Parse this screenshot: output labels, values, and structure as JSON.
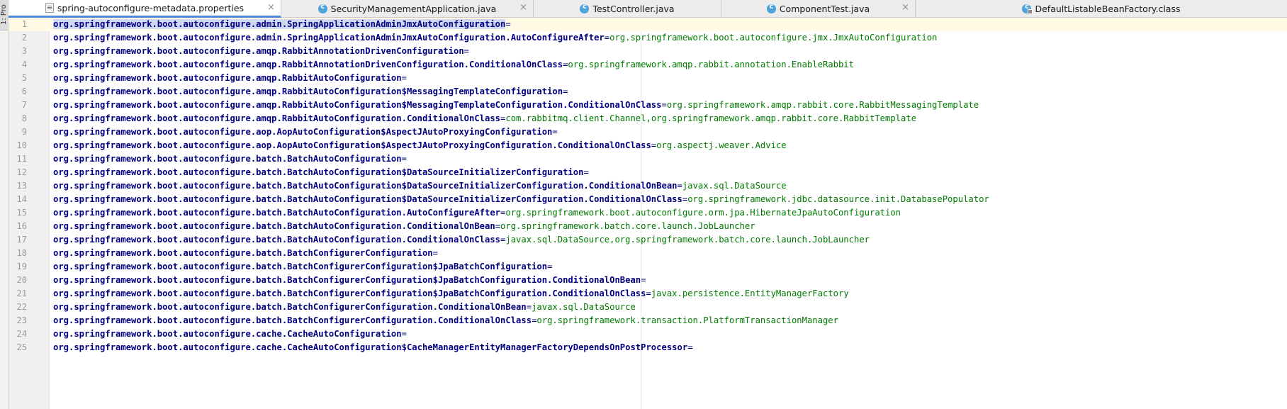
{
  "side_panel": {
    "label": "1: Pro"
  },
  "tabs": [
    {
      "label": "spring-autoconfigure-metadata.properties",
      "icon": "properties-file-icon",
      "active": true,
      "closable": true
    },
    {
      "label": "SecurityManagementApplication.java",
      "icon": "java-class-icon",
      "active": false,
      "closable": true
    },
    {
      "label": "TestController.java",
      "icon": "java-class-icon",
      "active": false,
      "closable": true
    },
    {
      "label": "ComponentTest.java",
      "icon": "java-class-icon",
      "active": false,
      "closable": true
    },
    {
      "label": "DefaultListableBeanFactory.class",
      "icon": "compiled-class-icon",
      "active": false,
      "closable": false
    }
  ],
  "close_glyph": "×",
  "editor": {
    "current_line": 1,
    "lines": [
      {
        "n": "1",
        "key": "org.springframework.boot.autoconfigure.admin.SpringApplicationAdminJmxAutoConfiguration",
        "eq": "=",
        "value": ""
      },
      {
        "n": "2",
        "key": "org.springframework.boot.autoconfigure.admin.SpringApplicationAdminJmxAutoConfiguration.AutoConfigureAfter",
        "eq": "=",
        "value": "org.springframework.boot.autoconfigure.jmx.JmxAutoConfiguration"
      },
      {
        "n": "3",
        "key": "org.springframework.boot.autoconfigure.amqp.RabbitAnnotationDrivenConfiguration",
        "eq": "=",
        "value": ""
      },
      {
        "n": "4",
        "key": "org.springframework.boot.autoconfigure.amqp.RabbitAnnotationDrivenConfiguration.ConditionalOnClass",
        "eq": "=",
        "value": "org.springframework.amqp.rabbit.annotation.EnableRabbit"
      },
      {
        "n": "5",
        "key": "org.springframework.boot.autoconfigure.amqp.RabbitAutoConfiguration",
        "eq": "=",
        "value": ""
      },
      {
        "n": "6",
        "key": "org.springframework.boot.autoconfigure.amqp.RabbitAutoConfiguration$MessagingTemplateConfiguration",
        "eq": "=",
        "value": ""
      },
      {
        "n": "7",
        "key": "org.springframework.boot.autoconfigure.amqp.RabbitAutoConfiguration$MessagingTemplateConfiguration.ConditionalOnClass",
        "eq": "=",
        "value": "org.springframework.amqp.rabbit.core.RabbitMessagingTemplate"
      },
      {
        "n": "8",
        "key": "org.springframework.boot.autoconfigure.amqp.RabbitAutoConfiguration.ConditionalOnClass",
        "eq": "=",
        "value": "com.rabbitmq.client.Channel,org.springframework.amqp.rabbit.core.RabbitTemplate"
      },
      {
        "n": "9",
        "key": "org.springframework.boot.autoconfigure.aop.AopAutoConfiguration$AspectJAutoProxyingConfiguration",
        "eq": "=",
        "value": ""
      },
      {
        "n": "10",
        "key": "org.springframework.boot.autoconfigure.aop.AopAutoConfiguration$AspectJAutoProxyingConfiguration.ConditionalOnClass",
        "eq": "=",
        "value": "org.aspectj.weaver.Advice"
      },
      {
        "n": "11",
        "key": "org.springframework.boot.autoconfigure.batch.BatchAutoConfiguration",
        "eq": "=",
        "value": ""
      },
      {
        "n": "12",
        "key": "org.springframework.boot.autoconfigure.batch.BatchAutoConfiguration$DataSourceInitializerConfiguration",
        "eq": "=",
        "value": ""
      },
      {
        "n": "13",
        "key": "org.springframework.boot.autoconfigure.batch.BatchAutoConfiguration$DataSourceInitializerConfiguration.ConditionalOnBean",
        "eq": "=",
        "value": "javax.sql.DataSource"
      },
      {
        "n": "14",
        "key": "org.springframework.boot.autoconfigure.batch.BatchAutoConfiguration$DataSourceInitializerConfiguration.ConditionalOnClass",
        "eq": "=",
        "value": "org.springframework.jdbc.datasource.init.DatabasePopulator"
      },
      {
        "n": "15",
        "key": "org.springframework.boot.autoconfigure.batch.BatchAutoConfiguration.AutoConfigureAfter",
        "eq": "=",
        "value": "org.springframework.boot.autoconfigure.orm.jpa.HibernateJpaAutoConfiguration"
      },
      {
        "n": "16",
        "key": "org.springframework.boot.autoconfigure.batch.BatchAutoConfiguration.ConditionalOnBean",
        "eq": "=",
        "value": "org.springframework.batch.core.launch.JobLauncher"
      },
      {
        "n": "17",
        "key": "org.springframework.boot.autoconfigure.batch.BatchAutoConfiguration.ConditionalOnClass",
        "eq": "=",
        "value": "javax.sql.DataSource,org.springframework.batch.core.launch.JobLauncher"
      },
      {
        "n": "18",
        "key": "org.springframework.boot.autoconfigure.batch.BatchConfigurerConfiguration",
        "eq": "=",
        "value": ""
      },
      {
        "n": "19",
        "key": "org.springframework.boot.autoconfigure.batch.BatchConfigurerConfiguration$JpaBatchConfiguration",
        "eq": "=",
        "value": ""
      },
      {
        "n": "20",
        "key": "org.springframework.boot.autoconfigure.batch.BatchConfigurerConfiguration$JpaBatchConfiguration.ConditionalOnBean",
        "eq": "=",
        "value": ""
      },
      {
        "n": "21",
        "key": "org.springframework.boot.autoconfigure.batch.BatchConfigurerConfiguration$JpaBatchConfiguration.ConditionalOnClass",
        "eq": "=",
        "value": "javax.persistence.EntityManagerFactory"
      },
      {
        "n": "22",
        "key": "org.springframework.boot.autoconfigure.batch.BatchConfigurerConfiguration.ConditionalOnBean",
        "eq": "=",
        "value": "javax.sql.DataSource"
      },
      {
        "n": "23",
        "key": "org.springframework.boot.autoconfigure.batch.BatchConfigurerConfiguration.ConditionalOnClass",
        "eq": "=",
        "value": "org.springframework.transaction.PlatformTransactionManager"
      },
      {
        "n": "24",
        "key": "org.springframework.boot.autoconfigure.cache.CacheAutoConfiguration",
        "eq": "=",
        "value": ""
      },
      {
        "n": "25",
        "key": "org.springframework.boot.autoconfigure.cache.CacheAutoConfiguration$CacheManagerEntityManagerFactoryDependsOnPostProcessor",
        "eq": "=",
        "value": ""
      }
    ]
  }
}
